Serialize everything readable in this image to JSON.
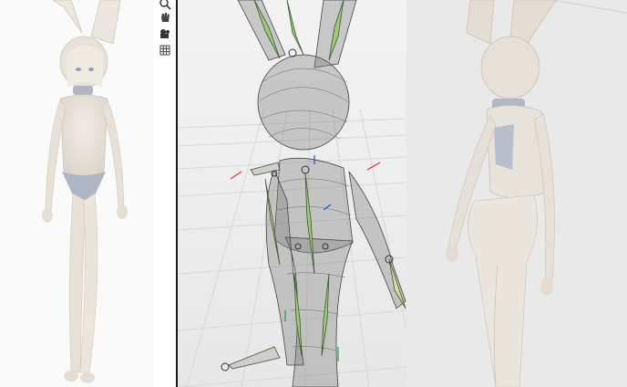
{
  "window": {
    "panels": [
      "render-preview-front",
      "3d-viewport-wireframe",
      "render-preview-back"
    ]
  },
  "toolbar": {
    "view_tools": [
      {
        "icon": "zoom-icon"
      },
      {
        "icon": "hand-pan-icon"
      },
      {
        "icon": "camera-icon"
      },
      {
        "icon": "grid-icon"
      }
    ],
    "buttons": [
      {
        "icon": "move-arrows-icon",
        "active": true
      },
      {
        "icon": "rotate-icon",
        "active": false
      },
      {
        "icon": "scale-icon",
        "active": false
      },
      {
        "icon": "transform-gizmo-icon",
        "active": false
      },
      {
        "icon": "pen-bone-icon",
        "active": false
      },
      {
        "icon": "angle-measure-icon",
        "active": false
      },
      {
        "icon": "curve-icon",
        "active": false
      }
    ]
  },
  "colors": {
    "active_tool": "#4a8ff0",
    "bone_fill": "#9fc87a",
    "bone_yellow": "#d8dc9a",
    "axis_red": "#e03030",
    "axis_blue": "#2050e0",
    "axis_green": "#20a040"
  }
}
